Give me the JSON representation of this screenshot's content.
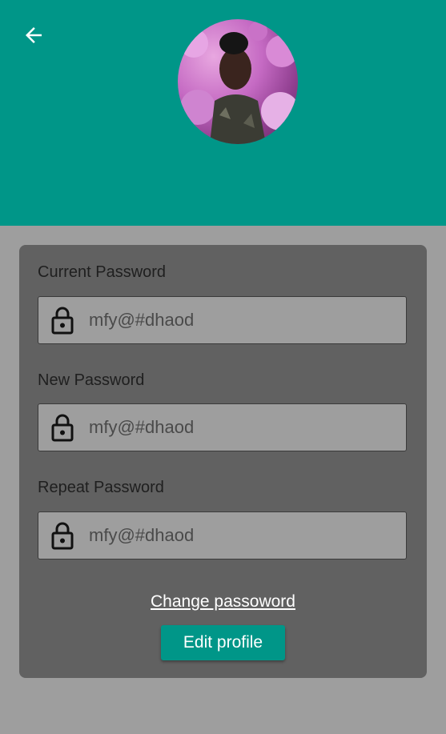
{
  "header": {
    "back_icon": "arrow-left-icon",
    "avatar_alt": "profile photo",
    "color": "#009688"
  },
  "form": {
    "current": {
      "label": "Current Password",
      "placeholder": "mfy@#dhaod",
      "icon": "lock-icon"
    },
    "new": {
      "label": "New Password",
      "placeholder": "mfy@#dhaod",
      "icon": "lock-icon"
    },
    "repeat": {
      "label": "Repeat Password",
      "placeholder": "mfy@#dhaod",
      "icon": "lock-icon"
    },
    "change_link": "Change passoword",
    "edit_button": "Edit profile"
  },
  "colors": {
    "accent": "#009688",
    "card": "#616161",
    "page": "#9e9e9e"
  }
}
